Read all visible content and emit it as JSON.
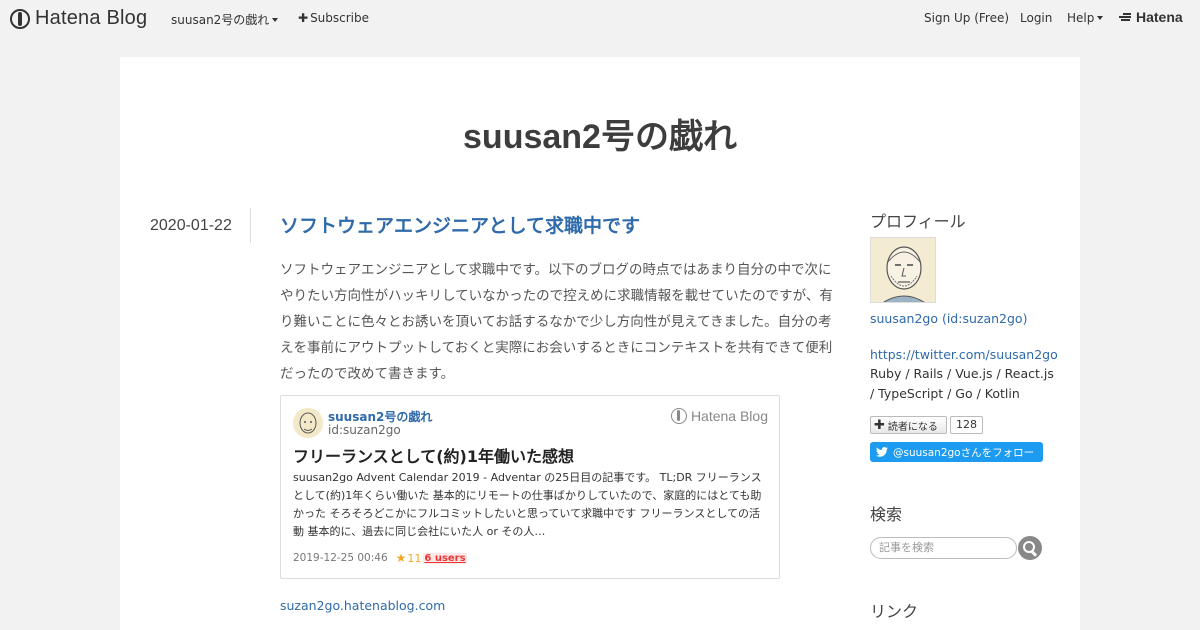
{
  "header": {
    "logo_text": "Hatena Blog",
    "blog_menu": "suusan2号の戯れ",
    "subscribe": "Subscribe",
    "signup": "Sign Up (Free)",
    "login": "Login",
    "help": "Help",
    "hatena_logo": "Hatena"
  },
  "blog": {
    "title": "suusan2号の戯れ"
  },
  "entry": {
    "date": "2020-01-22",
    "title": "ソフトウェアエンジニアとして求職中です",
    "body": "ソフトウェアエンジニアとして求職中です。以下のブログの時点ではあまり自分の中で次にやりたい方向性がハッキリしていなかったので控えめに求職情報を載せていたのですが、有り難いことに色々とお誘いを頂いてお話するなかで少し方向性が見えてきました。自分の考えを事前にアウトプットしておくと実際にお会いするときにコンテキストを共有できて便利だったので改めて書きます。",
    "link": "suzan2go.hatenablog.com"
  },
  "card": {
    "blog_name": "suusan2号の戯れ",
    "blog_id": "id:suzan2go",
    "brand": "Hatena Blog",
    "title": "フリーランスとして(約)1年働いた感想",
    "description": "suusan2go Advent Calendar 2019 - Adventar の25日目の記事です。 TL;DR フリーランスとして(約)1年くらい働いた 基本的にリモートの仕事ばかりしていたので、家庭的にはとても助かった そろそろどこかにフルコミットしたいと思っていて求職中です フリーランスとしての活動 基本的に、過去に同じ会社にいた人 or その人…",
    "date": "2019-12-25 00:46",
    "stars": "11",
    "users": "6 users"
  },
  "sidebar": {
    "profile_heading": "プロフィール",
    "profile_name": "suusan2go (id:suzan2go)",
    "twitter_url": "https://twitter.com/suusan2go",
    "bio": "Ruby / Rails / Vue.js / React.js / TypeScript / Go / Kotlin",
    "reader_button": "読者になる",
    "reader_count": "128",
    "twitter_follow": "@suusan2goさんをフォロー",
    "search_heading": "検索",
    "search_placeholder": "記事を検索",
    "links_heading": "リンク"
  }
}
